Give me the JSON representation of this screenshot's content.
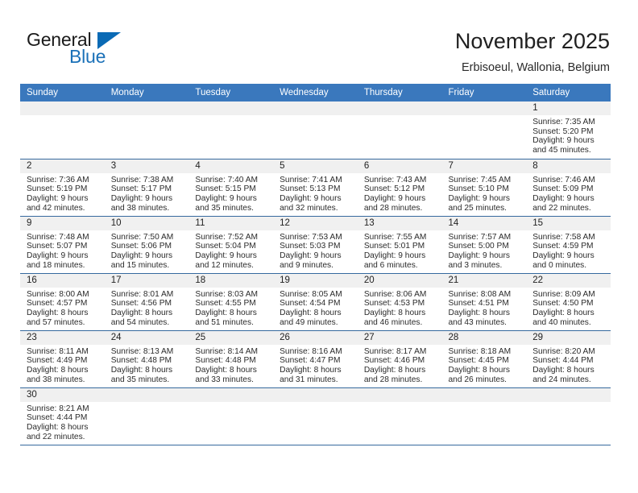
{
  "brand": {
    "name_part1": "General",
    "name_part2": "Blue",
    "triangle_color": "#0a6ab5",
    "blue_text_color": "#1b71b8"
  },
  "header": {
    "title": "November 2025",
    "subtitle": "Erbisoeul, Wallonia, Belgium"
  },
  "theme": {
    "header_bg": "#3a78bd",
    "row_border": "#36699e",
    "daynum_bg": "#f0f0f0"
  },
  "weekdays": [
    "Sunday",
    "Monday",
    "Tuesday",
    "Wednesday",
    "Thursday",
    "Friday",
    "Saturday"
  ],
  "weeks": [
    [
      {
        "day": "",
        "sunrise": "",
        "sunset": "",
        "daylight1": "",
        "daylight2": "",
        "blank": true
      },
      {
        "day": "",
        "sunrise": "",
        "sunset": "",
        "daylight1": "",
        "daylight2": "",
        "blank": true
      },
      {
        "day": "",
        "sunrise": "",
        "sunset": "",
        "daylight1": "",
        "daylight2": "",
        "blank": true
      },
      {
        "day": "",
        "sunrise": "",
        "sunset": "",
        "daylight1": "",
        "daylight2": "",
        "blank": true
      },
      {
        "day": "",
        "sunrise": "",
        "sunset": "",
        "daylight1": "",
        "daylight2": "",
        "blank": true
      },
      {
        "day": "",
        "sunrise": "",
        "sunset": "",
        "daylight1": "",
        "daylight2": "",
        "blank": true
      },
      {
        "day": "1",
        "sunrise": "Sunrise: 7:35 AM",
        "sunset": "Sunset: 5:20 PM",
        "daylight1": "Daylight: 9 hours",
        "daylight2": "and 45 minutes.",
        "blank": false
      }
    ],
    [
      {
        "day": "2",
        "sunrise": "Sunrise: 7:36 AM",
        "sunset": "Sunset: 5:19 PM",
        "daylight1": "Daylight: 9 hours",
        "daylight2": "and 42 minutes.",
        "blank": false
      },
      {
        "day": "3",
        "sunrise": "Sunrise: 7:38 AM",
        "sunset": "Sunset: 5:17 PM",
        "daylight1": "Daylight: 9 hours",
        "daylight2": "and 38 minutes.",
        "blank": false
      },
      {
        "day": "4",
        "sunrise": "Sunrise: 7:40 AM",
        "sunset": "Sunset: 5:15 PM",
        "daylight1": "Daylight: 9 hours",
        "daylight2": "and 35 minutes.",
        "blank": false
      },
      {
        "day": "5",
        "sunrise": "Sunrise: 7:41 AM",
        "sunset": "Sunset: 5:13 PM",
        "daylight1": "Daylight: 9 hours",
        "daylight2": "and 32 minutes.",
        "blank": false
      },
      {
        "day": "6",
        "sunrise": "Sunrise: 7:43 AM",
        "sunset": "Sunset: 5:12 PM",
        "daylight1": "Daylight: 9 hours",
        "daylight2": "and 28 minutes.",
        "blank": false
      },
      {
        "day": "7",
        "sunrise": "Sunrise: 7:45 AM",
        "sunset": "Sunset: 5:10 PM",
        "daylight1": "Daylight: 9 hours",
        "daylight2": "and 25 minutes.",
        "blank": false
      },
      {
        "day": "8",
        "sunrise": "Sunrise: 7:46 AM",
        "sunset": "Sunset: 5:09 PM",
        "daylight1": "Daylight: 9 hours",
        "daylight2": "and 22 minutes.",
        "blank": false
      }
    ],
    [
      {
        "day": "9",
        "sunrise": "Sunrise: 7:48 AM",
        "sunset": "Sunset: 5:07 PM",
        "daylight1": "Daylight: 9 hours",
        "daylight2": "and 18 minutes.",
        "blank": false
      },
      {
        "day": "10",
        "sunrise": "Sunrise: 7:50 AM",
        "sunset": "Sunset: 5:06 PM",
        "daylight1": "Daylight: 9 hours",
        "daylight2": "and 15 minutes.",
        "blank": false
      },
      {
        "day": "11",
        "sunrise": "Sunrise: 7:52 AM",
        "sunset": "Sunset: 5:04 PM",
        "daylight1": "Daylight: 9 hours",
        "daylight2": "and 12 minutes.",
        "blank": false
      },
      {
        "day": "12",
        "sunrise": "Sunrise: 7:53 AM",
        "sunset": "Sunset: 5:03 PM",
        "daylight1": "Daylight: 9 hours",
        "daylight2": "and 9 minutes.",
        "blank": false
      },
      {
        "day": "13",
        "sunrise": "Sunrise: 7:55 AM",
        "sunset": "Sunset: 5:01 PM",
        "daylight1": "Daylight: 9 hours",
        "daylight2": "and 6 minutes.",
        "blank": false
      },
      {
        "day": "14",
        "sunrise": "Sunrise: 7:57 AM",
        "sunset": "Sunset: 5:00 PM",
        "daylight1": "Daylight: 9 hours",
        "daylight2": "and 3 minutes.",
        "blank": false
      },
      {
        "day": "15",
        "sunrise": "Sunrise: 7:58 AM",
        "sunset": "Sunset: 4:59 PM",
        "daylight1": "Daylight: 9 hours",
        "daylight2": "and 0 minutes.",
        "blank": false
      }
    ],
    [
      {
        "day": "16",
        "sunrise": "Sunrise: 8:00 AM",
        "sunset": "Sunset: 4:57 PM",
        "daylight1": "Daylight: 8 hours",
        "daylight2": "and 57 minutes.",
        "blank": false
      },
      {
        "day": "17",
        "sunrise": "Sunrise: 8:01 AM",
        "sunset": "Sunset: 4:56 PM",
        "daylight1": "Daylight: 8 hours",
        "daylight2": "and 54 minutes.",
        "blank": false
      },
      {
        "day": "18",
        "sunrise": "Sunrise: 8:03 AM",
        "sunset": "Sunset: 4:55 PM",
        "daylight1": "Daylight: 8 hours",
        "daylight2": "and 51 minutes.",
        "blank": false
      },
      {
        "day": "19",
        "sunrise": "Sunrise: 8:05 AM",
        "sunset": "Sunset: 4:54 PM",
        "daylight1": "Daylight: 8 hours",
        "daylight2": "and 49 minutes.",
        "blank": false
      },
      {
        "day": "20",
        "sunrise": "Sunrise: 8:06 AM",
        "sunset": "Sunset: 4:53 PM",
        "daylight1": "Daylight: 8 hours",
        "daylight2": "and 46 minutes.",
        "blank": false
      },
      {
        "day": "21",
        "sunrise": "Sunrise: 8:08 AM",
        "sunset": "Sunset: 4:51 PM",
        "daylight1": "Daylight: 8 hours",
        "daylight2": "and 43 minutes.",
        "blank": false
      },
      {
        "day": "22",
        "sunrise": "Sunrise: 8:09 AM",
        "sunset": "Sunset: 4:50 PM",
        "daylight1": "Daylight: 8 hours",
        "daylight2": "and 40 minutes.",
        "blank": false
      }
    ],
    [
      {
        "day": "23",
        "sunrise": "Sunrise: 8:11 AM",
        "sunset": "Sunset: 4:49 PM",
        "daylight1": "Daylight: 8 hours",
        "daylight2": "and 38 minutes.",
        "blank": false
      },
      {
        "day": "24",
        "sunrise": "Sunrise: 8:13 AM",
        "sunset": "Sunset: 4:48 PM",
        "daylight1": "Daylight: 8 hours",
        "daylight2": "and 35 minutes.",
        "blank": false
      },
      {
        "day": "25",
        "sunrise": "Sunrise: 8:14 AM",
        "sunset": "Sunset: 4:48 PM",
        "daylight1": "Daylight: 8 hours",
        "daylight2": "and 33 minutes.",
        "blank": false
      },
      {
        "day": "26",
        "sunrise": "Sunrise: 8:16 AM",
        "sunset": "Sunset: 4:47 PM",
        "daylight1": "Daylight: 8 hours",
        "daylight2": "and 31 minutes.",
        "blank": false
      },
      {
        "day": "27",
        "sunrise": "Sunrise: 8:17 AM",
        "sunset": "Sunset: 4:46 PM",
        "daylight1": "Daylight: 8 hours",
        "daylight2": "and 28 minutes.",
        "blank": false
      },
      {
        "day": "28",
        "sunrise": "Sunrise: 8:18 AM",
        "sunset": "Sunset: 4:45 PM",
        "daylight1": "Daylight: 8 hours",
        "daylight2": "and 26 minutes.",
        "blank": false
      },
      {
        "day": "29",
        "sunrise": "Sunrise: 8:20 AM",
        "sunset": "Sunset: 4:44 PM",
        "daylight1": "Daylight: 8 hours",
        "daylight2": "and 24 minutes.",
        "blank": false
      }
    ],
    [
      {
        "day": "30",
        "sunrise": "Sunrise: 8:21 AM",
        "sunset": "Sunset: 4:44 PM",
        "daylight1": "Daylight: 8 hours",
        "daylight2": "and 22 minutes.",
        "blank": false
      },
      {
        "day": "",
        "sunrise": "",
        "sunset": "",
        "daylight1": "",
        "daylight2": "",
        "blank": true
      },
      {
        "day": "",
        "sunrise": "",
        "sunset": "",
        "daylight1": "",
        "daylight2": "",
        "blank": true
      },
      {
        "day": "",
        "sunrise": "",
        "sunset": "",
        "daylight1": "",
        "daylight2": "",
        "blank": true
      },
      {
        "day": "",
        "sunrise": "",
        "sunset": "",
        "daylight1": "",
        "daylight2": "",
        "blank": true
      },
      {
        "day": "",
        "sunrise": "",
        "sunset": "",
        "daylight1": "",
        "daylight2": "",
        "blank": true
      },
      {
        "day": "",
        "sunrise": "",
        "sunset": "",
        "daylight1": "",
        "daylight2": "",
        "blank": true
      }
    ]
  ]
}
